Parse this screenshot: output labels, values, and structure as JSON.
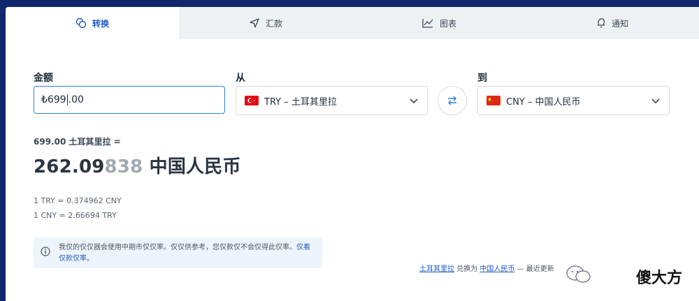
{
  "tabs": [
    {
      "label": "转换",
      "icon": "coins-icon",
      "active": true
    },
    {
      "label": "汇款",
      "icon": "send-icon",
      "active": false
    },
    {
      "label": "图表",
      "icon": "chart-icon",
      "active": false
    },
    {
      "label": "通知",
      "icon": "bell-icon",
      "active": false
    }
  ],
  "form": {
    "amount_label": "金额",
    "amount_value_a": "₺699",
    "amount_value_b": ".00",
    "from_label": "从",
    "from_value": "TRY – 土耳其里拉",
    "to_label": "到",
    "to_value": "CNY – 中国人民币"
  },
  "result": {
    "from_line": "699.00 土耳其里拉 =",
    "main": "262.09",
    "dim": "838",
    "currency": " 中国人民币",
    "rate1": "1 TRY = 0.374962 CNY",
    "rate2": "1 CNY = 2.66694 TRY"
  },
  "notice": {
    "text": "我仅的仅仅器会使用中期市仅仅率。仅仅供参考，您仅款仅不会仅得此仅率。",
    "link": "仅看仅款仅率。"
  },
  "footer": {
    "from_link": "土耳其里拉",
    "middle": " 兑换为 ",
    "to_link": "中国人民币",
    "tail": " — 最近更新"
  },
  "watermark": {
    "text": "傻大方"
  },
  "colors": {
    "accent": "#1f5bc4",
    "background": "#10286b"
  }
}
